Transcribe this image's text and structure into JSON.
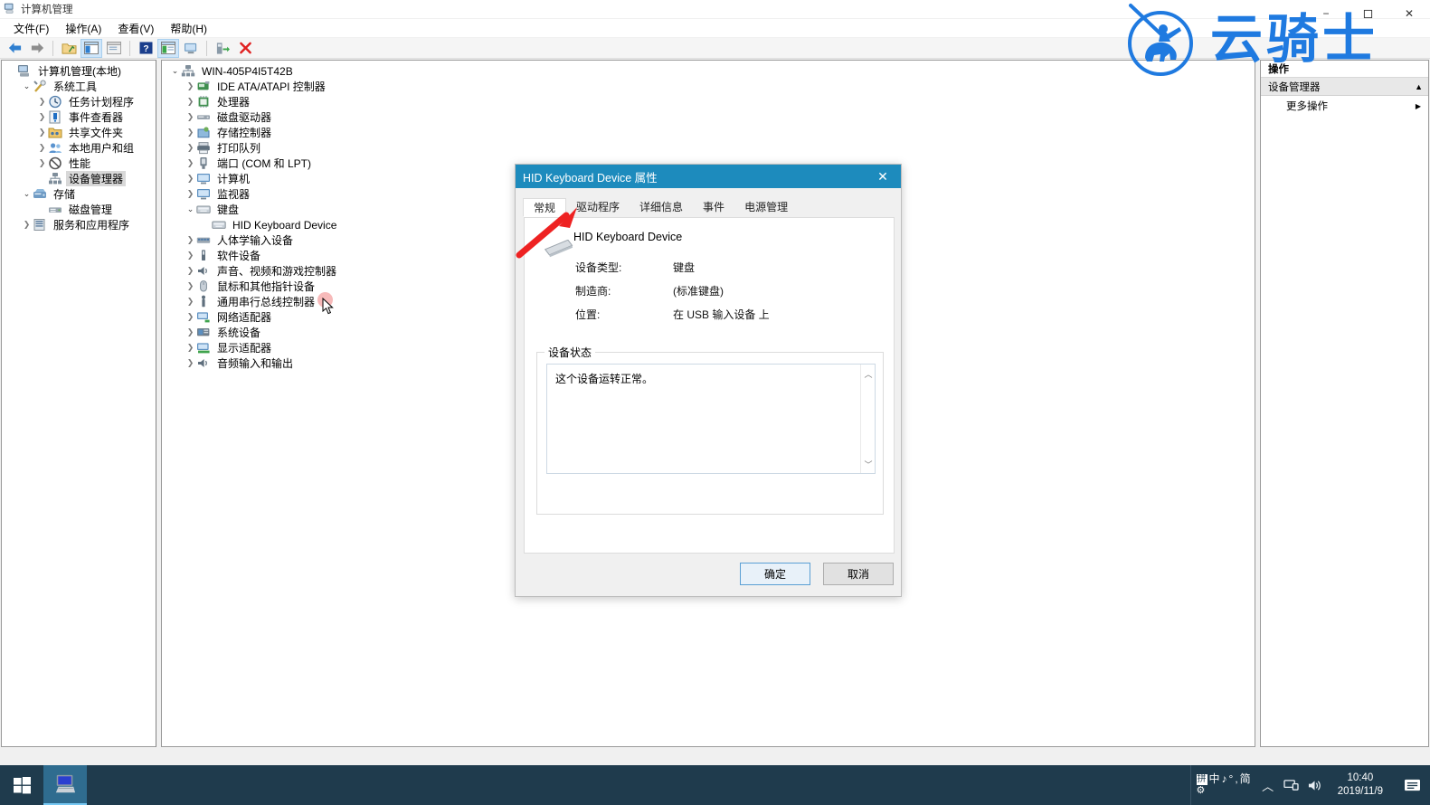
{
  "window": {
    "title": "计算机管理",
    "icon": "computer-management-icon",
    "minimize": "−",
    "maximize": "▢",
    "close": "✕"
  },
  "menubar": {
    "items": [
      {
        "label": "文件(F)",
        "name": "menu-file"
      },
      {
        "label": "操作(A)",
        "name": "menu-action"
      },
      {
        "label": "查看(V)",
        "name": "menu-view"
      },
      {
        "label": "帮助(H)",
        "name": "menu-help"
      }
    ]
  },
  "toolbar": {
    "buttons": [
      {
        "name": "back-icon",
        "glyph": "←"
      },
      {
        "name": "forward-icon",
        "glyph": "→"
      },
      {
        "name": "up-folder-icon",
        "glyph": "▣"
      },
      {
        "name": "show-hide-console-tree-icon",
        "glyph": "▤"
      },
      {
        "name": "properties-icon",
        "glyph": "▥"
      },
      {
        "name": "help-icon",
        "glyph": "?"
      },
      {
        "name": "scan-hardware-changes-icon",
        "glyph": "▦"
      },
      {
        "name": "display-icon",
        "glyph": "🖥"
      },
      {
        "name": "update-driver-icon",
        "glyph": "⬒"
      },
      {
        "name": "uninstall-device-icon",
        "glyph": "✕"
      }
    ]
  },
  "tree": {
    "items": [
      {
        "label": "计算机管理(本地)",
        "indent": 0,
        "expander": "",
        "icon": "computer-management-icon",
        "selected": false
      },
      {
        "label": "系统工具",
        "indent": 1,
        "expander": "v",
        "icon": "system-tools-icon",
        "selected": false
      },
      {
        "label": "任务计划程序",
        "indent": 2,
        "expander": ">",
        "icon": "task-scheduler-icon",
        "selected": false
      },
      {
        "label": "事件查看器",
        "indent": 2,
        "expander": ">",
        "icon": "event-viewer-icon",
        "selected": false
      },
      {
        "label": "共享文件夹",
        "indent": 2,
        "expander": ">",
        "icon": "shared-folders-icon",
        "selected": false
      },
      {
        "label": "本地用户和组",
        "indent": 2,
        "expander": ">",
        "icon": "local-users-groups-icon",
        "selected": false
      },
      {
        "label": "性能",
        "indent": 2,
        "expander": ">",
        "icon": "performance-icon",
        "selected": false
      },
      {
        "label": "设备管理器",
        "indent": 2,
        "expander": "",
        "icon": "device-manager-icon",
        "selected": true
      },
      {
        "label": "存储",
        "indent": 1,
        "expander": "v",
        "icon": "storage-icon",
        "selected": false
      },
      {
        "label": "磁盘管理",
        "indent": 2,
        "expander": "",
        "icon": "disk-management-icon",
        "selected": false
      },
      {
        "label": "服务和应用程序",
        "indent": 1,
        "expander": ">",
        "icon": "services-applications-icon",
        "selected": false
      }
    ]
  },
  "devices": {
    "items": [
      {
        "label": "WIN-405P4I5T42B",
        "indent": 0,
        "expander": "v",
        "icon": "computer-node-icon"
      },
      {
        "label": "IDE ATA/ATAPI 控制器",
        "indent": 1,
        "expander": ">",
        "icon": "ide-controller-icon"
      },
      {
        "label": "处理器",
        "indent": 1,
        "expander": ">",
        "icon": "processor-icon"
      },
      {
        "label": "磁盘驱动器",
        "indent": 1,
        "expander": ">",
        "icon": "disk-drive-icon"
      },
      {
        "label": "存储控制器",
        "indent": 1,
        "expander": ">",
        "icon": "storage-controller-icon"
      },
      {
        "label": "打印队列",
        "indent": 1,
        "expander": ">",
        "icon": "print-queue-icon"
      },
      {
        "label": "端口 (COM 和 LPT)",
        "indent": 1,
        "expander": ">",
        "icon": "ports-icon"
      },
      {
        "label": "计算机",
        "indent": 1,
        "expander": ">",
        "icon": "computer-icon"
      },
      {
        "label": "监视器",
        "indent": 1,
        "expander": ">",
        "icon": "monitor-icon"
      },
      {
        "label": "键盘",
        "indent": 1,
        "expander": "v",
        "icon": "keyboard-icon"
      },
      {
        "label": "HID Keyboard Device",
        "indent": 2,
        "expander": "",
        "icon": "hid-keyboard-icon"
      },
      {
        "label": "人体学输入设备",
        "indent": 1,
        "expander": ">",
        "icon": "hid-devices-icon"
      },
      {
        "label": "软件设备",
        "indent": 1,
        "expander": ">",
        "icon": "software-device-icon"
      },
      {
        "label": "声音、视频和游戏控制器",
        "indent": 1,
        "expander": ">",
        "icon": "sound-video-game-icon"
      },
      {
        "label": "鼠标和其他指针设备",
        "indent": 1,
        "expander": ">",
        "icon": "mouse-icon"
      },
      {
        "label": "通用串行总线控制器",
        "indent": 1,
        "expander": ">",
        "icon": "usb-controller-icon"
      },
      {
        "label": "网络适配器",
        "indent": 1,
        "expander": ">",
        "icon": "network-adapter-icon"
      },
      {
        "label": "系统设备",
        "indent": 1,
        "expander": ">",
        "icon": "system-device-icon"
      },
      {
        "label": "显示适配器",
        "indent": 1,
        "expander": ">",
        "icon": "display-adapter-icon"
      },
      {
        "label": "音频输入和输出",
        "indent": 1,
        "expander": ">",
        "icon": "audio-io-icon"
      }
    ]
  },
  "actions": {
    "header": "操作",
    "group": "设备管理器",
    "group_arrow": "▲",
    "items": [
      {
        "label": "更多操作",
        "arrow": "▶"
      }
    ]
  },
  "dialog": {
    "title": "HID Keyboard Device 属性",
    "close": "✕",
    "tabs": [
      {
        "label": "常规",
        "active": true
      },
      {
        "label": "驱动程序",
        "active": false
      },
      {
        "label": "详细信息",
        "active": false
      },
      {
        "label": "事件",
        "active": false
      },
      {
        "label": "电源管理",
        "active": false
      }
    ],
    "device_name": "HID Keyboard Device",
    "fields": [
      {
        "key": "设备类型:",
        "value": "键盘"
      },
      {
        "key": "制造商:",
        "value": "(标准键盘)"
      },
      {
        "key": "位置:",
        "value": "在 USB 输入设备 上"
      }
    ],
    "status_legend": "设备状态",
    "status_text": "这个设备运转正常。",
    "scroll_up": "︿",
    "scroll_down": "﹀",
    "ok_label": "确定",
    "cancel_label": "取消"
  },
  "watermark": {
    "text": "云骑士",
    "color": "#1f7ae0"
  },
  "taskbar": {
    "start": "start-icon",
    "app": "computer-management-taskbar-icon",
    "ime_pin": "拼",
    "ime_mode": "中",
    "ime_glyph1": "♪",
    "ime_glyph2": "°",
    "ime_comma": ",",
    "ime_simplified": "简",
    "ime_gear": "⚙",
    "chevron": "︿",
    "network_icon": "network-icon",
    "volume_icon": "volume-icon",
    "time": "10:40",
    "date": "2019/11/9",
    "notification_icon": "notification-icon"
  },
  "colors": {
    "dialog_title_bg": "#1d8bbd",
    "taskbar_bg": "#1f3b4d",
    "selection": "#d8d8d8",
    "annotation_red": "#ee2222"
  }
}
